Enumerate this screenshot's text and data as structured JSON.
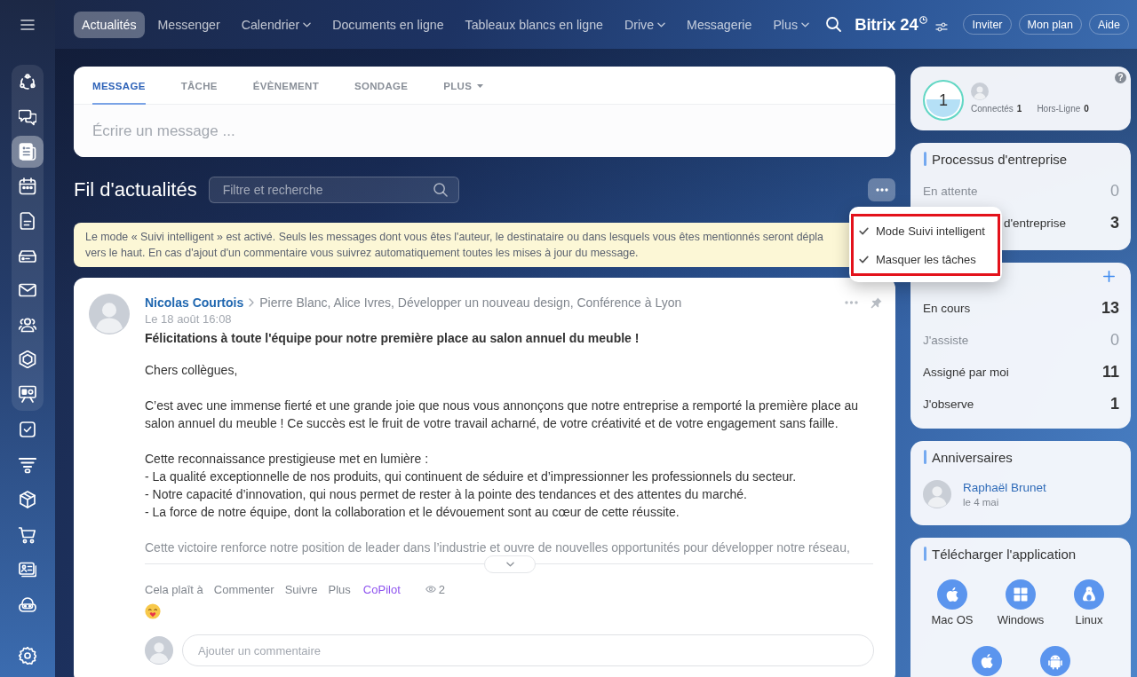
{
  "sidebar": {
    "pinned_items": [
      {
        "selected": false
      },
      {
        "selected": false
      },
      {
        "selected": true
      },
      {
        "selected": false
      },
      {
        "selected": false
      },
      {
        "selected": false
      },
      {
        "selected": false
      },
      {
        "selected": false
      },
      {
        "selected": false
      },
      {
        "selected": false
      }
    ],
    "more_items": [
      {
        "selected": false
      },
      {
        "selected": false
      },
      {
        "selected": false
      },
      {
        "selected": false
      },
      {
        "selected": false
      },
      {
        "selected": false
      }
    ]
  },
  "top_nav": {
    "tabs": [
      {
        "label": "Actualités",
        "selected": true,
        "has_menu": false
      },
      {
        "label": "Messenger",
        "selected": false,
        "has_menu": false
      },
      {
        "label": "Calendrier",
        "selected": false,
        "has_menu": true
      },
      {
        "label": "Documents en ligne",
        "selected": false,
        "has_menu": false
      },
      {
        "label": "Tableaux blancs en ligne",
        "selected": false,
        "has_menu": false
      },
      {
        "label": "Drive",
        "selected": false,
        "has_menu": true
      },
      {
        "label": "Messagerie",
        "selected": false,
        "has_menu": false
      },
      {
        "label": "Plus",
        "selected": false,
        "has_menu": true
      }
    ],
    "logo": "Bitrix 24",
    "buttons": [
      "Inviter",
      "Mon plan",
      "Aide"
    ]
  },
  "composer": {
    "tabs": [
      {
        "label": "MESSAGE",
        "selected": true,
        "has_menu": false
      },
      {
        "label": "TÂCHE",
        "selected": false,
        "has_menu": false
      },
      {
        "label": "ÉVÈNEMENT",
        "selected": false,
        "has_menu": false
      },
      {
        "label": "SONDAGE",
        "selected": false,
        "has_menu": false
      },
      {
        "label": "PLUS",
        "selected": false,
        "has_menu": true
      }
    ],
    "placeholder": "Écrire un message ..."
  },
  "feed": {
    "title": "Fil d'actualités",
    "search": {
      "placeholder": "Filtre et recherche"
    },
    "menu": {
      "highlighted": true,
      "items": [
        {
          "label": "Mode Suivi intelligent",
          "checked": true
        },
        {
          "label": "Masquer les tâches",
          "checked": true
        }
      ]
    },
    "notice": {
      "lines": [
        "Le mode « Suivi intelligent » est activé. Seuls les messages dont vous êtes l'auteur, le destinataire ou dans lesquels vous êtes mentionnés seront dépla",
        "vers le haut. En cas d'ajout d'un commentaire vous suivrez automatiquement toutes les mises à jour du message."
      ]
    },
    "post": {
      "author": "Nicolas Courtois",
      "recipients": "Pierre Blanc, Alice Ivres, Développer un nouveau design, Conférence à Lyon",
      "date": "Le 18 août 16:08",
      "title": "Félicitations à toute l'équipe pour notre première place au salon annuel du meuble !",
      "body": [
        [
          "Chers collègues,"
        ],
        [
          "C’est avec une immense fierté et une grande joie que nous vous annonçons que notre entreprise a remporté la première place au salon annuel du meuble ! Ce succès est le fruit de votre travail acharné, de votre créativité et de votre engagement sans faille."
        ],
        [
          "Cette reconnaissance prestigieuse met en lumière :",
          "- La qualité exceptionnelle de nos produits, qui continuent de séduire et d’impressionner les professionnels du secteur.",
          "- Notre capacité d’innovation, qui nous permet de rester à la pointe des tendances et des attentes du marché.",
          "- La force de notre équipe, dont la collaboration et le dévouement sont au cœur de cette réussite."
        ],
        [
          "Cette victoire renforce notre position de leader dans l’industrie et ouvre de nouvelles opportunités pour développer notre réseau,"
        ]
      ],
      "actions": [
        {
          "label": "Cela plaît à",
          "kind": "link"
        },
        {
          "label": "Commenter",
          "kind": "link"
        },
        {
          "label": "Suivre",
          "kind": "link"
        },
        {
          "label": "Plus",
          "kind": "link"
        },
        {
          "label": "CoPilot",
          "kind": "copilot"
        }
      ],
      "views": "2",
      "comment_placeholder": "Ajouter un commentaire"
    }
  },
  "right_column": {
    "online": {
      "count": "1",
      "stats": [
        {
          "label": "Connectés",
          "value": "1"
        },
        {
          "label": "Hors-Ligne",
          "value": "0"
        }
      ],
      "help": "?"
    },
    "processes": {
      "title": "Processus d'entreprise",
      "rows": [
        {
          "label": "En attente",
          "count": "0",
          "muted": true,
          "partly_covered": false
        },
        {
          "label": "d'entreprise",
          "count": "3",
          "muted": false,
          "partly_covered": true
        }
      ]
    },
    "tasks": {
      "rows": [
        {
          "label": "En cours",
          "count": "13",
          "muted": false
        },
        {
          "label": "J'assiste",
          "count": "0",
          "muted": true
        },
        {
          "label": "Assigné par moi",
          "count": "11",
          "muted": false
        },
        {
          "label": "J'observe",
          "count": "1",
          "muted": false
        }
      ]
    },
    "birthdays": {
      "title": "Anniversaires",
      "people": [
        {
          "name": "Raphaël Brunet",
          "date": "le 4 mai"
        }
      ]
    },
    "apps": {
      "title": "Télécharger l'application",
      "items": [
        {
          "label": "Mac OS",
          "kind": "apple"
        },
        {
          "label": "Windows",
          "kind": "windows"
        },
        {
          "label": "Linux",
          "kind": "linux"
        },
        {
          "kind": "apple"
        },
        {
          "kind": "android"
        }
      ]
    }
  }
}
